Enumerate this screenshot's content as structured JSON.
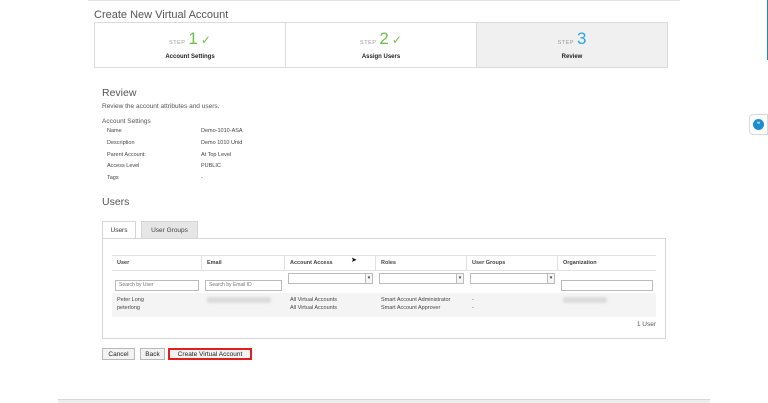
{
  "page": {
    "title": "Create New Virtual Account"
  },
  "steps": [
    {
      "word": "STEP",
      "number": "1",
      "label": "Account Settings",
      "state": "done"
    },
    {
      "word": "STEP",
      "number": "2",
      "label": "Assign Users",
      "state": "done"
    },
    {
      "word": "STEP",
      "number": "3",
      "label": "Review",
      "state": "active"
    }
  ],
  "review": {
    "heading": "Review",
    "description": "Review the account attributes and users.",
    "section_title": "Account Settings",
    "fields": [
      {
        "label": "Name",
        "value": "Demo-1010-ASA"
      },
      {
        "label": "Description",
        "value": "Demo 1010 Unid"
      },
      {
        "label": "Parent Account:",
        "value": "At Top Level"
      },
      {
        "label": "Access Level",
        "value": "PUBLIC"
      },
      {
        "label": "Tags",
        "value": "-"
      }
    ]
  },
  "users": {
    "heading": "Users",
    "tabs": [
      {
        "label": "Users"
      },
      {
        "label": "User Groups"
      }
    ],
    "columns": [
      "User",
      "Email",
      "Account Access",
      "Roles",
      "User Groups",
      "Organization"
    ],
    "filters": {
      "user_placeholder": "Search by User",
      "email_placeholder": "Search by Email ID"
    },
    "rows": [
      {
        "user_line1": "Peter Long",
        "user_line2": "peterlong",
        "access_line1": "All Virtual Accounts",
        "access_line2": "All Virtual Accounts",
        "roles_line1": "Smart Account Administrator",
        "roles_line2": "Smart Account Approver",
        "groups_line1": "-",
        "groups_line2": "-"
      }
    ],
    "count_text": "1 User"
  },
  "buttons": {
    "cancel": "Cancel",
    "back": "Back",
    "create": "Create Virtual Account"
  },
  "colors": {
    "step_done": "#6cc04a",
    "step_active": "#2aa7dc",
    "highlight": "#e0201f"
  }
}
